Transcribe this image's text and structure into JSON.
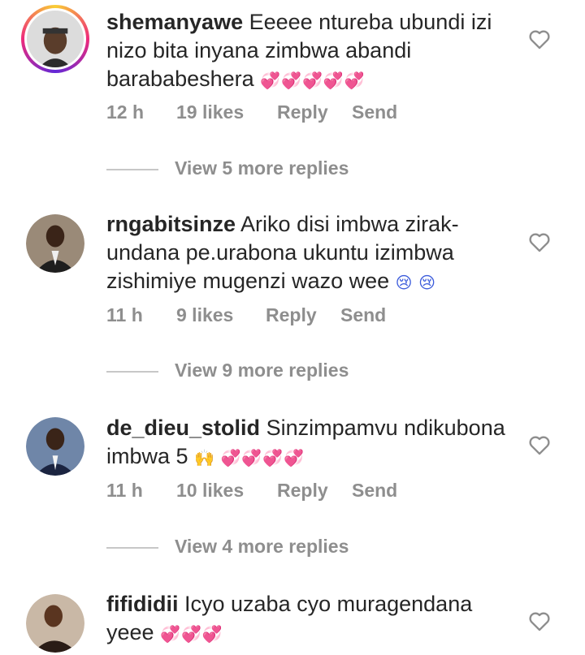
{
  "comments": [
    {
      "username": "shemanyawe",
      "text": "Eeeee ntureba ubundi izi nizo bita inyana zimbwa abandi barababeshera",
      "emoji": "💞💞💞💞💞",
      "time": "12 h",
      "likes": "19 likes",
      "reply": "Reply",
      "send": "Send",
      "view_more": "View 5 more replies"
    },
    {
      "username": "rngabitsinze",
      "text": "Ariko disi imbwa zirak-undana pe.urabona ukuntu izimbwa zishimiye mugenzi wazo wee",
      "emoji": "😢 😢",
      "time": "11 h",
      "likes": "9 likes",
      "reply": "Reply",
      "send": "Send",
      "view_more": "View 9 more replies"
    },
    {
      "username": "de_dieu_stolid",
      "text": "Sinzimpamvu ndikubona imbwa 5",
      "emoji": "🙌 💞💞💞💞",
      "time": "11 h",
      "likes": "10 likes",
      "reply": "Reply",
      "send": "Send",
      "view_more": "View 4 more replies"
    },
    {
      "username": "fifididii",
      "text": "Icyo uzaba cyo muragendana yeee",
      "emoji": "💞💞💞",
      "time": "",
      "likes": "",
      "reply": "",
      "send": "",
      "view_more": ""
    }
  ],
  "icons": {
    "heart": "heart-outline-icon"
  },
  "colors": {
    "text": "#262626",
    "muted": "#8e8e8e",
    "emoji_pink": "#e5399c"
  }
}
